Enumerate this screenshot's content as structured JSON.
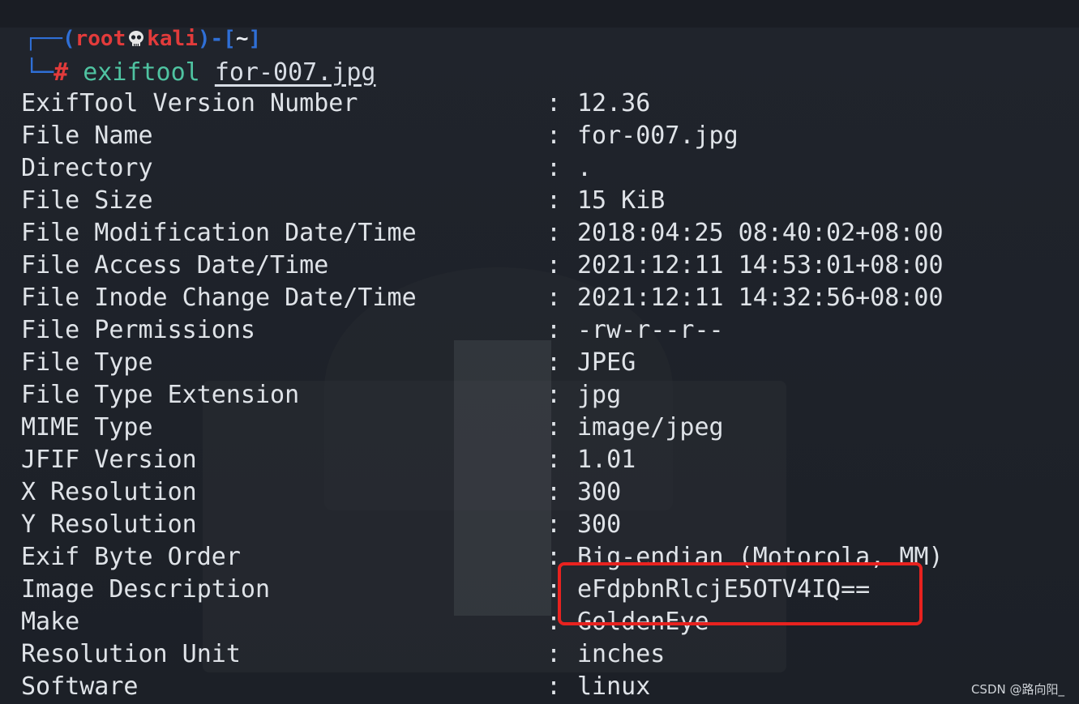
{
  "prompt": {
    "open": "┌──(",
    "user": "root",
    "host": "kali",
    "mid": ")-[",
    "path": "~",
    "close": "]",
    "corner": "└─",
    "symbol": "#",
    "command": "exiftool",
    "argument": "for-007.jpg"
  },
  "exif_rows": [
    {
      "key": "ExifTool Version Number",
      "value": "12.36"
    },
    {
      "key": "File Name",
      "value": "for-007.jpg"
    },
    {
      "key": "Directory",
      "value": "."
    },
    {
      "key": "File Size",
      "value": "15 KiB"
    },
    {
      "key": "File Modification Date/Time",
      "value": "2018:04:25 08:40:02+08:00"
    },
    {
      "key": "File Access Date/Time",
      "value": "2021:12:11 14:53:01+08:00"
    },
    {
      "key": "File Inode Change Date/Time",
      "value": "2021:12:11 14:32:56+08:00"
    },
    {
      "key": "File Permissions",
      "value": "-rw-r--r--"
    },
    {
      "key": "File Type",
      "value": "JPEG"
    },
    {
      "key": "File Type Extension",
      "value": "jpg"
    },
    {
      "key": "MIME Type",
      "value": "image/jpeg"
    },
    {
      "key": "JFIF Version",
      "value": "1.01"
    },
    {
      "key": "X Resolution",
      "value": "300"
    },
    {
      "key": "Y Resolution",
      "value": "300"
    },
    {
      "key": "Exif Byte Order",
      "value": "Big-endian (Motorola, MM)"
    },
    {
      "key": "Image Description",
      "value": "eFdpbnRlcjE5OTV4IQ=="
    },
    {
      "key": "Make",
      "value": "GoldenEye"
    },
    {
      "key": "Resolution Unit",
      "value": "inches"
    },
    {
      "key": "Software",
      "value": "linux"
    }
  ],
  "separator": ":",
  "watermark": "CSDN @路向阳_",
  "colors": {
    "background": "#1d2128",
    "prompt_blue": "#2f6fd6",
    "prompt_red": "#e23b3b",
    "command_green": "#4fc3a1",
    "text": "#dfe3e8",
    "highlight": "#e8221f"
  },
  "icons": {
    "skull": "skull-icon"
  }
}
